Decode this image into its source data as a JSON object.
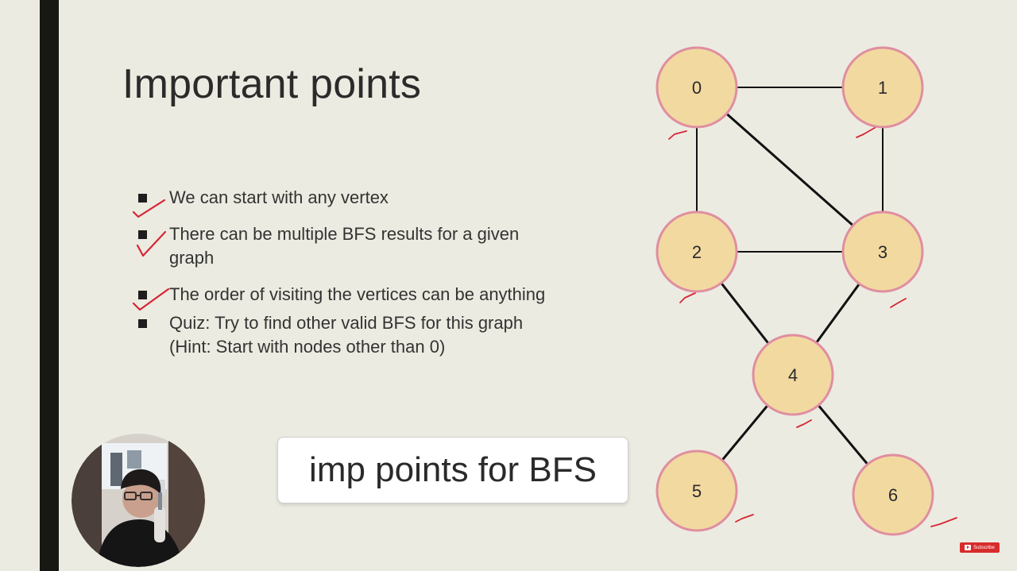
{
  "slide": {
    "title": "Important points",
    "bullets": [
      {
        "lines": [
          "We can start with any vertex"
        ]
      },
      {
        "lines": [
          "There can be multiple BFS results for a given",
          "graph"
        ]
      },
      {
        "lines": [
          "The order of visiting the vertices can be anything"
        ]
      },
      {
        "lines": [
          "Quiz: Try to find other valid BFS for this graph",
          "(Hint: Start with nodes other than 0)"
        ]
      }
    ]
  },
  "graph": {
    "nodes": [
      {
        "id": "0",
        "label": "0"
      },
      {
        "id": "1",
        "label": "1"
      },
      {
        "id": "2",
        "label": "2"
      },
      {
        "id": "3",
        "label": "3"
      },
      {
        "id": "4",
        "label": "4"
      },
      {
        "id": "5",
        "label": "5"
      },
      {
        "id": "6",
        "label": "6"
      }
    ],
    "edges": [
      [
        "0",
        "1"
      ],
      [
        "0",
        "2"
      ],
      [
        "0",
        "3"
      ],
      [
        "1",
        "3"
      ],
      [
        "2",
        "3"
      ],
      [
        "2",
        "4"
      ],
      [
        "3",
        "4"
      ],
      [
        "4",
        "5"
      ],
      [
        "4",
        "6"
      ]
    ],
    "colors": {
      "node_fill": "#f2d9a0",
      "node_stroke": "#df8ea1",
      "edge": "#111111",
      "tick": "#d62634"
    }
  },
  "caption": {
    "text": "imp points for BFS"
  },
  "subscribe": {
    "label": "Subscribe",
    "icon": "youtube-play-icon"
  },
  "webcam": {
    "icon": "presenter-webcam-image"
  }
}
